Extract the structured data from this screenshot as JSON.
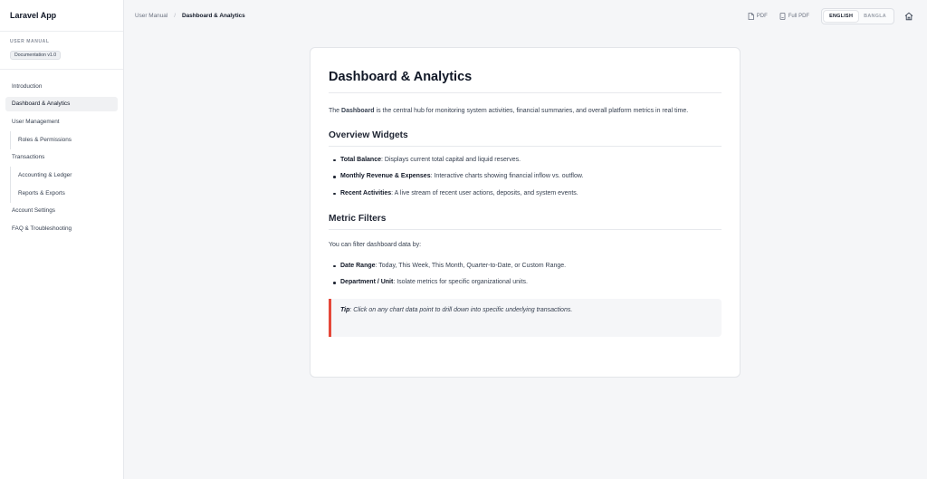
{
  "sidebar": {
    "brand": "Laravel App",
    "overline": "USER MANUAL",
    "version": "Documentation v1.0",
    "items": [
      {
        "label": "Introduction"
      },
      {
        "label": "Dashboard & Analytics"
      },
      {
        "label": "User Management"
      },
      {
        "label": "Roles & Permissions"
      },
      {
        "label": "Transactions"
      },
      {
        "label": "Accounting & Ledger"
      },
      {
        "label": "Reports & Exports"
      },
      {
        "label": "Account Settings"
      },
      {
        "label": "FAQ & Troubleshooting"
      }
    ]
  },
  "topbar": {
    "breadcrumb_root": "User Manual",
    "breadcrumb_sep": "/",
    "breadcrumb_current": "Dashboard & Analytics",
    "pdf_label": "PDF",
    "full_pdf_label": "Full PDF",
    "lang_english": "ENGLISH",
    "lang_bangla": "BANGLA"
  },
  "content": {
    "title": "Dashboard & Analytics",
    "intro_prefix": "The ",
    "intro_bold": "Dashboard",
    "intro_rest": " is the central hub for monitoring system activities, financial summaries, and overall platform metrics in real time.",
    "section1_title": "Overview Widgets",
    "widgets": [
      {
        "term": "Total Balance",
        "desc": ": Displays current total capital and liquid reserves."
      },
      {
        "term": "Monthly Revenue & Expenses",
        "desc": ": Interactive charts showing financial inflow vs. outflow."
      },
      {
        "term": "Recent Activities",
        "desc": ": A live stream of recent user actions, deposits, and system events."
      }
    ],
    "section2_title": "Metric Filters",
    "filters_intro": "You can filter dashboard data by:",
    "filters": [
      {
        "term": "Date Range",
        "desc": ": Today, This Week, This Month, Quarter-to-Date, or Custom Range."
      },
      {
        "term": "Department / Unit",
        "desc": ": Isolate metrics for specific organizational units."
      }
    ],
    "tip_label": "Tip",
    "tip_text": ": Click on any chart data point to drill down into specific underlying transactions."
  },
  "colors": {
    "tip_accent": "#e5483a",
    "active_nav_bg": "#f0f1f3"
  },
  "icons": {
    "pdf": "file-icon",
    "full_pdf": "document-icon",
    "home": "home-icon"
  }
}
